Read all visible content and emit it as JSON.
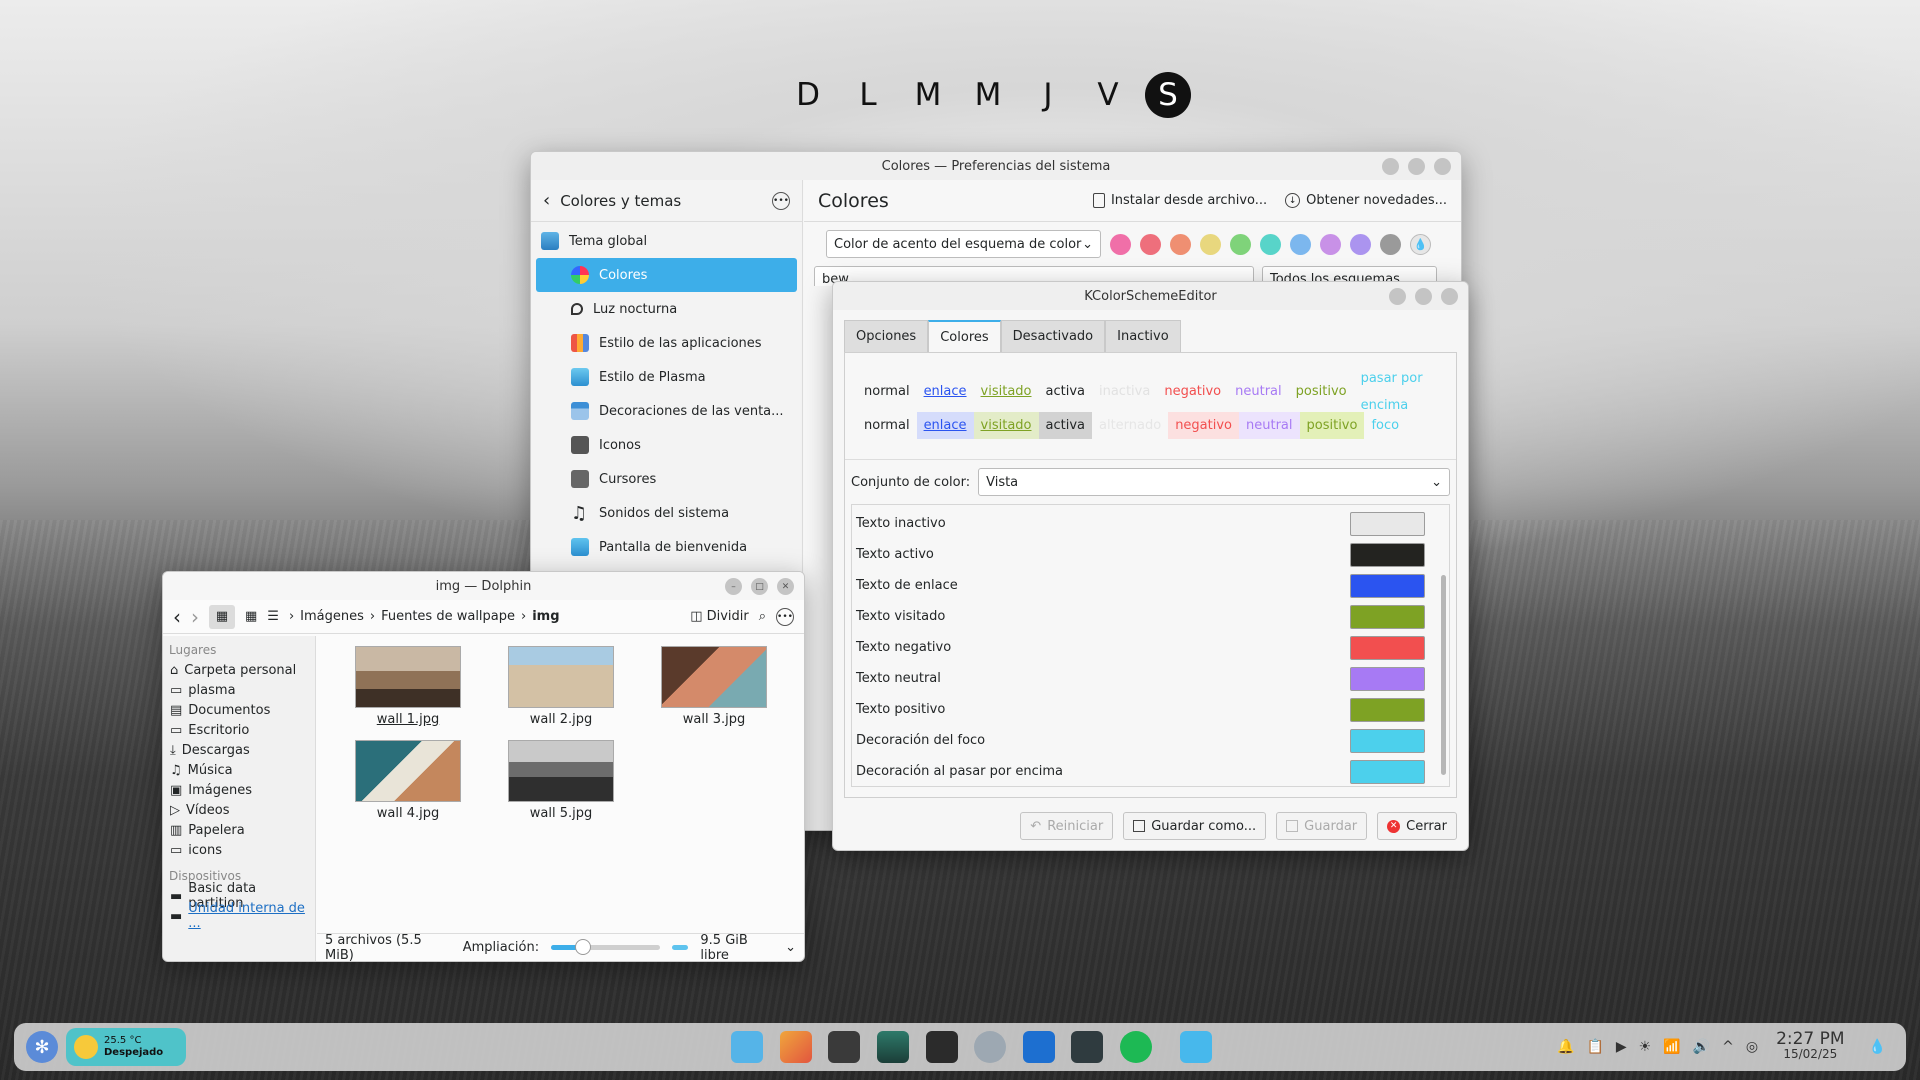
{
  "calendar": {
    "days": [
      "D",
      "L",
      "M",
      "M",
      "J",
      "V",
      "S"
    ]
  },
  "sysset": {
    "title": "Colores — Preferencias del sistema",
    "back_title": "Colores y temas",
    "page_title": "Colores",
    "install_label": "Instalar desde archivo...",
    "get_new_label": "Obtener novedades...",
    "nav": [
      "Tema global",
      "Colores",
      "Luz nocturna",
      "Estilo de las aplicaciones",
      "Estilo de Plasma",
      "Decoraciones de las venta...",
      "Iconos",
      "Cursores",
      "Sonidos del sistema",
      "Pantalla de bienvenida"
    ],
    "accent_combo": "Color de acento del esquema de color",
    "accent_swatches": [
      "#f06fa8",
      "#ee6f7c",
      "#ef8f72",
      "#e8d77e",
      "#7fd37a",
      "#58d4c9",
      "#7cb7ee",
      "#c891e7",
      "#ab94ef",
      "#9a9a9a"
    ],
    "search_value": "bew",
    "filter_label": "Todos los esquemas"
  },
  "kcse": {
    "title": "KColorSchemeEditor",
    "tabs": [
      "Opciones",
      "Colores",
      "Desactivado",
      "Inactivo"
    ],
    "preview_row1": [
      "normal",
      "enlace",
      "visitado",
      "activa",
      "inactiva",
      "negativo",
      "neutral",
      "positivo",
      "pasar por encima"
    ],
    "preview_row2": [
      "normal",
      "enlace",
      "visitado",
      "activa",
      "alternado",
      "negativo",
      "neutral",
      "positivo",
      "foco"
    ],
    "color_set_label": "Conjunto de color:",
    "color_set_value": "Vista",
    "colors": [
      {
        "name": "Texto inactivo",
        "hex": "#e8e8e8"
      },
      {
        "name": "Texto activo",
        "hex": "#232320"
      },
      {
        "name": "Texto de enlace",
        "hex": "#2b54f0"
      },
      {
        "name": "Texto visitado",
        "hex": "#7ea224"
      },
      {
        "name": "Texto negativo",
        "hex": "#f24f4f"
      },
      {
        "name": "Texto neutral",
        "hex": "#a77af4"
      },
      {
        "name": "Texto positivo",
        "hex": "#7ea224"
      },
      {
        "name": "Decoración del foco",
        "hex": "#4cd0ec"
      },
      {
        "name": "Decoración al pasar por encima",
        "hex": "#4cd0ec"
      }
    ],
    "btn_reset": "Reiniciar",
    "btn_save_as": "Guardar como...",
    "btn_save": "Guardar",
    "btn_close": "Cerrar"
  },
  "dolphin": {
    "title": "img — Dolphin",
    "crumbs": [
      "Imágenes",
      "Fuentes de wallpape",
      "img"
    ],
    "split_label": "Dividir",
    "places_header": "Lugares",
    "places": [
      "Carpeta personal",
      "plasma",
      "Documentos",
      "Escritorio",
      "Descargas",
      "Música",
      "Imágenes",
      "Vídeos",
      "Papelera",
      "icons"
    ],
    "devices_header": "Dispositivos",
    "devices": [
      "Basic data partition",
      "Unidad interna de ..."
    ],
    "files": [
      "wall 1.jpg",
      "wall 2.jpg",
      "wall 3.jpg",
      "wall 4.jpg",
      "wall 5.jpg"
    ],
    "status": "5 archivos (5.5 MiB)",
    "zoom_label": "Ampliación:",
    "free": "9.5 GiB libre"
  },
  "taskbar": {
    "temp": "25.5 °C",
    "weather": "Despejado",
    "time": "2:27 PM",
    "date": "15/02/25"
  }
}
